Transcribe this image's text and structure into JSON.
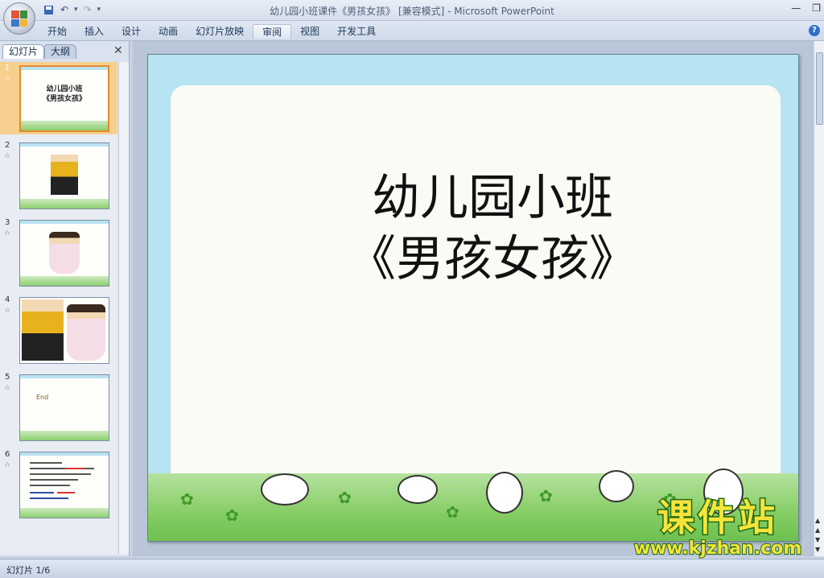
{
  "window": {
    "title": "幼儿园小班课件《男孩女孩》 [兼容模式] - Microsoft PowerPoint"
  },
  "ribbon": {
    "tabs": [
      "开始",
      "插入",
      "设计",
      "动画",
      "幻灯片放映",
      "审阅",
      "视图",
      "开发工具"
    ],
    "active_tab": "审阅"
  },
  "panel": {
    "tabs": [
      "幻灯片",
      "大纲"
    ],
    "close_icon": "close-icon"
  },
  "thumbnails": [
    {
      "num": "1",
      "title_line1": "幼儿园小班",
      "title_line2": "《男孩女孩》",
      "selected": true
    },
    {
      "num": "2"
    },
    {
      "num": "3"
    },
    {
      "num": "4"
    },
    {
      "num": "5",
      "text": "End"
    },
    {
      "num": "6"
    }
  ],
  "slide": {
    "title_line1": "幼儿园小班",
    "title_line2": "《男孩女孩》"
  },
  "watermark": {
    "main": "课件站",
    "sub": "www.kjzhan.com"
  },
  "status": {
    "slide_indicator": "幻灯片 1/6"
  },
  "colors": {
    "accent": "#e48a2f",
    "ribbon": "#dfe7f2",
    "sky": "#b7e4f2",
    "grass": "#84cc62"
  }
}
